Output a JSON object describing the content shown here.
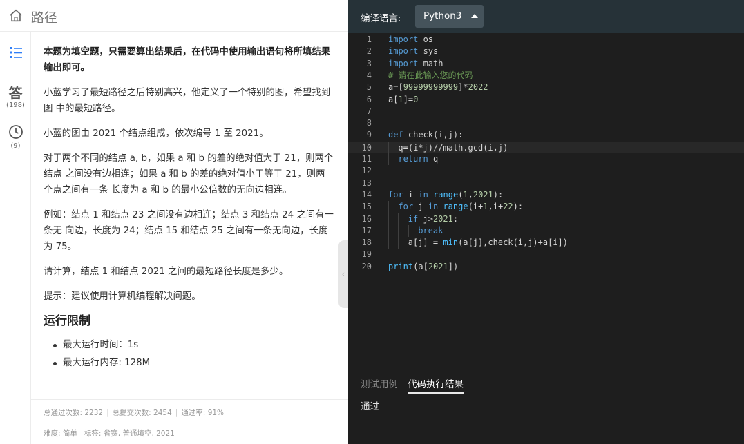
{
  "header": {
    "title": "路径"
  },
  "rail": {
    "answer_char": "答",
    "answer_count": "(198)",
    "history_count": "(9)"
  },
  "problem": {
    "paragraphs": [
      {
        "text": "本题为填空题，只需要算出结果后，在代码中使用输出语句将所填结果输出即可。",
        "bold": true
      },
      {
        "text": "小蓝学习了最短路径之后特别高兴，他定义了一个特别的图，希望找到图 中的最短路径。",
        "bold": false
      },
      {
        "text": "小蓝的图由 2021 个结点组成，依次编号 1 至 2021。",
        "bold": false
      },
      {
        "text": "对于两个不同的结点 a, b，如果 a 和 b 的差的绝对值大于 21，则两个结点 之间没有边相连；如果 a 和 b 的差的绝对值小于等于 21，则两个点之间有一条 长度为 a 和 b 的最小公倍数的无向边相连。",
        "bold": false
      },
      {
        "text": "例如：结点 1 和结点 23 之间没有边相连；结点 3 和结点 24 之间有一条无 向边，长度为 24；结点 15 和结点 25 之间有一条无向边，长度为 75。",
        "bold": false
      },
      {
        "text": "请计算，结点 1 和结点 2021 之间的最短路径长度是多少。",
        "bold": false
      },
      {
        "text": "提示：建议使用计算机编程解决问题。",
        "bold": false
      }
    ],
    "limits_title": "运行限制",
    "limits": [
      "最大运行时间：1s",
      "最大运行内存: 128M"
    ]
  },
  "stats": {
    "passed": "总通过次数: 2232",
    "submitted": "总提交次数: 2454",
    "rate": "通过率: 91%",
    "difficulty": "难度: 简单",
    "tags": "标签: 省赛, 普通填空, 2021"
  },
  "editor": {
    "lang_label": "编译语言:",
    "language": "Python3",
    "lines": [
      {
        "n": "1",
        "indent": 0,
        "tokens": [
          [
            "kw",
            "import"
          ],
          [
            "plain",
            " os"
          ]
        ]
      },
      {
        "n": "2",
        "indent": 0,
        "tokens": [
          [
            "kw",
            "import"
          ],
          [
            "plain",
            " sys"
          ]
        ]
      },
      {
        "n": "3",
        "indent": 0,
        "tokens": [
          [
            "kw",
            "import"
          ],
          [
            "plain",
            " math"
          ]
        ]
      },
      {
        "n": "4",
        "indent": 0,
        "tokens": [
          [
            "cm",
            "# 请在此输入您的代码"
          ]
        ]
      },
      {
        "n": "5",
        "indent": 0,
        "tokens": [
          [
            "plain",
            "a=["
          ],
          [
            "num",
            "99999999999"
          ],
          [
            "plain",
            "]*"
          ],
          [
            "num",
            "2022"
          ]
        ]
      },
      {
        "n": "6",
        "indent": 0,
        "tokens": [
          [
            "plain",
            "a["
          ],
          [
            "num",
            "1"
          ],
          [
            "plain",
            "]="
          ],
          [
            "num",
            "0"
          ]
        ]
      },
      {
        "n": "7",
        "indent": 0,
        "tokens": []
      },
      {
        "n": "8",
        "indent": 0,
        "tokens": []
      },
      {
        "n": "9",
        "indent": 0,
        "tokens": [
          [
            "kw",
            "def"
          ],
          [
            "plain",
            " check(i,j):"
          ]
        ]
      },
      {
        "n": "10",
        "indent": 1,
        "active": true,
        "tokens": [
          [
            "plain",
            "q=(i*j)//math.gcd(i,j)"
          ]
        ]
      },
      {
        "n": "11",
        "indent": 1,
        "tokens": [
          [
            "kw",
            "return"
          ],
          [
            "plain",
            " q"
          ]
        ]
      },
      {
        "n": "12",
        "indent": 0,
        "tokens": []
      },
      {
        "n": "13",
        "indent": 0,
        "tokens": []
      },
      {
        "n": "14",
        "indent": 0,
        "tokens": [
          [
            "kw",
            "for"
          ],
          [
            "plain",
            " i "
          ],
          [
            "kw",
            "in"
          ],
          [
            "plain",
            " "
          ],
          [
            "fn",
            "range"
          ],
          [
            "plain",
            "("
          ],
          [
            "num",
            "1"
          ],
          [
            "plain",
            ","
          ],
          [
            "num",
            "2021"
          ],
          [
            "plain",
            "):"
          ]
        ]
      },
      {
        "n": "15",
        "indent": 1,
        "tokens": [
          [
            "kw",
            "for"
          ],
          [
            "plain",
            " j "
          ],
          [
            "kw",
            "in"
          ],
          [
            "plain",
            " "
          ],
          [
            "fn",
            "range"
          ],
          [
            "plain",
            "(i+"
          ],
          [
            "num",
            "1"
          ],
          [
            "plain",
            ",i+"
          ],
          [
            "num",
            "22"
          ],
          [
            "plain",
            "):"
          ]
        ]
      },
      {
        "n": "16",
        "indent": 2,
        "tokens": [
          [
            "kw",
            "if"
          ],
          [
            "plain",
            " j>"
          ],
          [
            "num",
            "2021"
          ],
          [
            "plain",
            ":"
          ]
        ]
      },
      {
        "n": "17",
        "indent": 3,
        "tokens": [
          [
            "kw",
            "break"
          ]
        ]
      },
      {
        "n": "18",
        "indent": 2,
        "tokens": [
          [
            "plain",
            "a[j] = "
          ],
          [
            "fn",
            "min"
          ],
          [
            "plain",
            "(a[j],check(i,j)+a[i])"
          ]
        ]
      },
      {
        "n": "19",
        "indent": 0,
        "tokens": []
      },
      {
        "n": "20",
        "indent": 0,
        "tokens": [
          [
            "fn",
            "print"
          ],
          [
            "plain",
            "(a["
          ],
          [
            "num",
            "2021"
          ],
          [
            "plain",
            "])"
          ]
        ]
      }
    ]
  },
  "bottom": {
    "tab_testcase": "测试用例",
    "tab_result": "代码执行结果",
    "result": "通过"
  },
  "colors": {
    "keyword": "#569cd6",
    "comment": "#6a9955",
    "number": "#b5cea8",
    "builtin": "#4fc1ff",
    "text": "#d4d4d4"
  }
}
